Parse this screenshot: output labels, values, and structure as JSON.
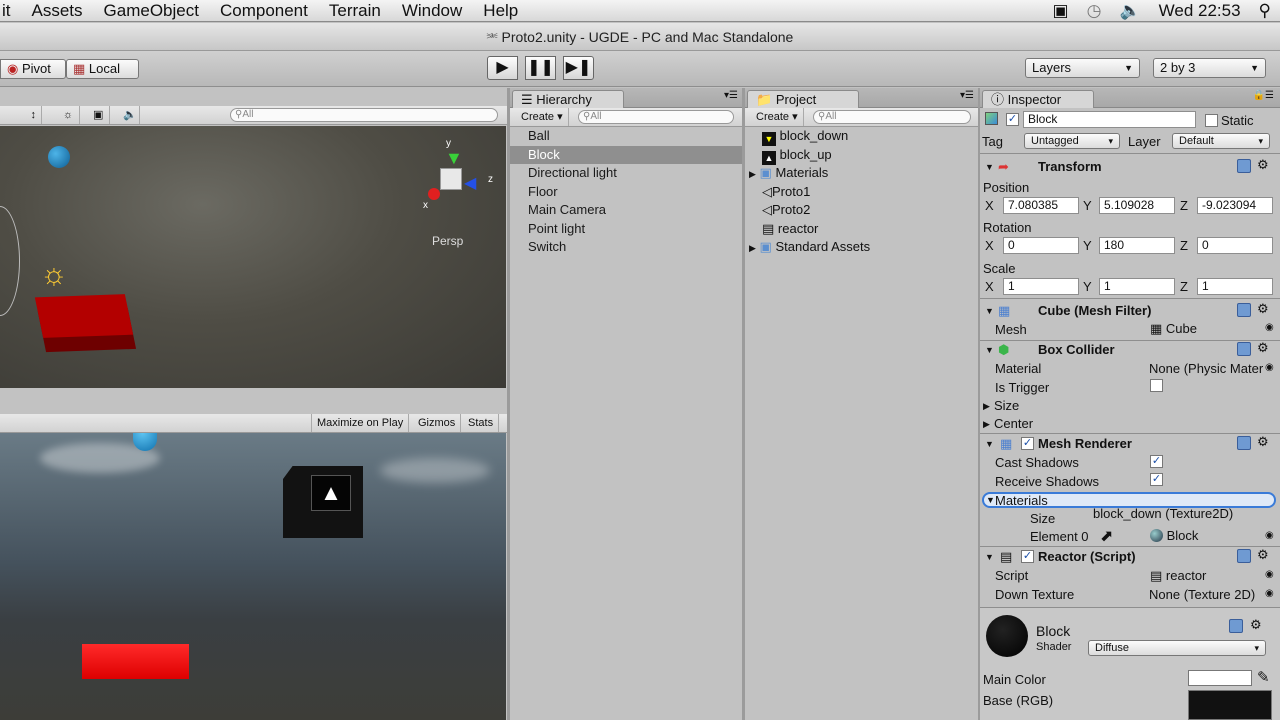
{
  "menubar": {
    "items": [
      "it",
      "Assets",
      "GameObject",
      "Component",
      "Terrain",
      "Window",
      "Help"
    ],
    "clock": "Wed 22:53"
  },
  "window": {
    "title": "Proto2.unity - UGDE - PC and Mac Standalone"
  },
  "toolbar": {
    "pivot": "Pivot",
    "local": "Local",
    "layers": "Layers",
    "layout": "2 by 3"
  },
  "scene": {
    "persp": "Persp",
    "search_placeholder": "All"
  },
  "game": {
    "maximize": "Maximize on Play",
    "gizmos": "Gizmos",
    "stats": "Stats"
  },
  "hierarchy": {
    "tab": "Hierarchy",
    "create": "Create",
    "search_placeholder": "All",
    "items": [
      "Ball",
      "Block",
      "Directional light",
      "Floor",
      "Main Camera",
      "Point light",
      "Switch"
    ],
    "selected": "Block"
  },
  "project": {
    "tab": "Project",
    "create": "Create",
    "search_placeholder": "All",
    "items": [
      "block_down",
      "block_up",
      "Materials",
      "Proto1",
      "Proto2",
      "reactor",
      "Standard Assets"
    ]
  },
  "inspector": {
    "tab": "Inspector",
    "object_name": "Block",
    "static_label": "Static",
    "tag_label": "Tag",
    "tag_value": "Untagged",
    "layer_label": "Layer",
    "layer_value": "Default",
    "transform": {
      "title": "Transform",
      "position_label": "Position",
      "rotation_label": "Rotation",
      "scale_label": "Scale",
      "axis_x": "X",
      "axis_y": "Y",
      "axis_z": "Z",
      "position": {
        "x": "7.080385",
        "y": "5.109028",
        "z": "-9.023094"
      },
      "rotation": {
        "x": "0",
        "y": "180",
        "z": "0"
      },
      "scale": {
        "x": "1",
        "y": "1",
        "z": "1"
      }
    },
    "mesh_filter": {
      "title": "Cube (Mesh Filter)",
      "mesh_label": "Mesh",
      "mesh_value": "Cube"
    },
    "box_collider": {
      "title": "Box Collider",
      "material_label": "Material",
      "material_value": "None (Physic Mater",
      "is_trigger_label": "Is Trigger",
      "size_label": "Size",
      "center_label": "Center"
    },
    "mesh_renderer": {
      "title": "Mesh Renderer",
      "cast_shadows": "Cast Shadows",
      "receive_shadows": "Receive Shadows",
      "materials": "Materials",
      "size": "Size",
      "drag_preview": "block_down (Texture2D)",
      "element0_label": "Element 0",
      "element0_value": "Block"
    },
    "reactor": {
      "title": "Reactor (Script)",
      "script_label": "Script",
      "script_value": "reactor",
      "down_texture_label": "Down Texture",
      "down_texture_value": "None (Texture 2D)"
    },
    "material": {
      "name": "Block",
      "shader_label": "Shader",
      "shader_value": "Diffuse",
      "main_color": "Main Color",
      "base_rgb": "Base (RGB)"
    }
  }
}
